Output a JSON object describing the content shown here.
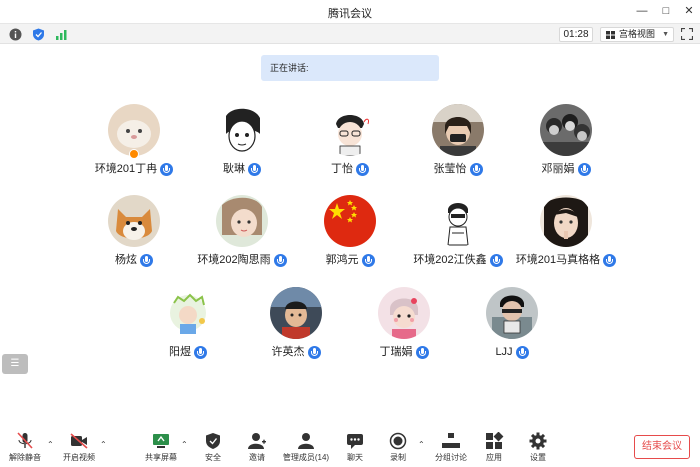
{
  "window": {
    "title": "腾讯会议"
  },
  "status": {
    "timer": "01:28",
    "view_label": "宫格视图"
  },
  "speaking_label": "正在讲话:",
  "participants": [
    {
      "name": "环境201丁冉"
    },
    {
      "name": "耿琳"
    },
    {
      "name": "丁怡"
    },
    {
      "name": "张莹怡"
    },
    {
      "name": "邓丽娟"
    },
    {
      "name": "杨炫"
    },
    {
      "name": "环境202陶思雨"
    },
    {
      "name": "郭鸿元"
    },
    {
      "name": "环境202江佚鑫"
    },
    {
      "name": "环境201马真格格"
    },
    {
      "name": "阳煜"
    },
    {
      "name": "许英杰"
    },
    {
      "name": "丁瑞娟"
    },
    {
      "name": "LJJ"
    }
  ],
  "toolbar": {
    "unmute": "解除静音",
    "video": "开启视频",
    "share": "共享屏幕",
    "security": "安全",
    "invite": "邀请",
    "members": "管理成员(14)",
    "chat": "聊天",
    "record": "录制",
    "breakout": "分组讨论",
    "apps": "应用",
    "settings": "设置",
    "end": "结束会议"
  },
  "colors": {
    "accent": "#2f79e8",
    "end": "#e64b4b",
    "speaking_bg": "#dbe8fb"
  }
}
